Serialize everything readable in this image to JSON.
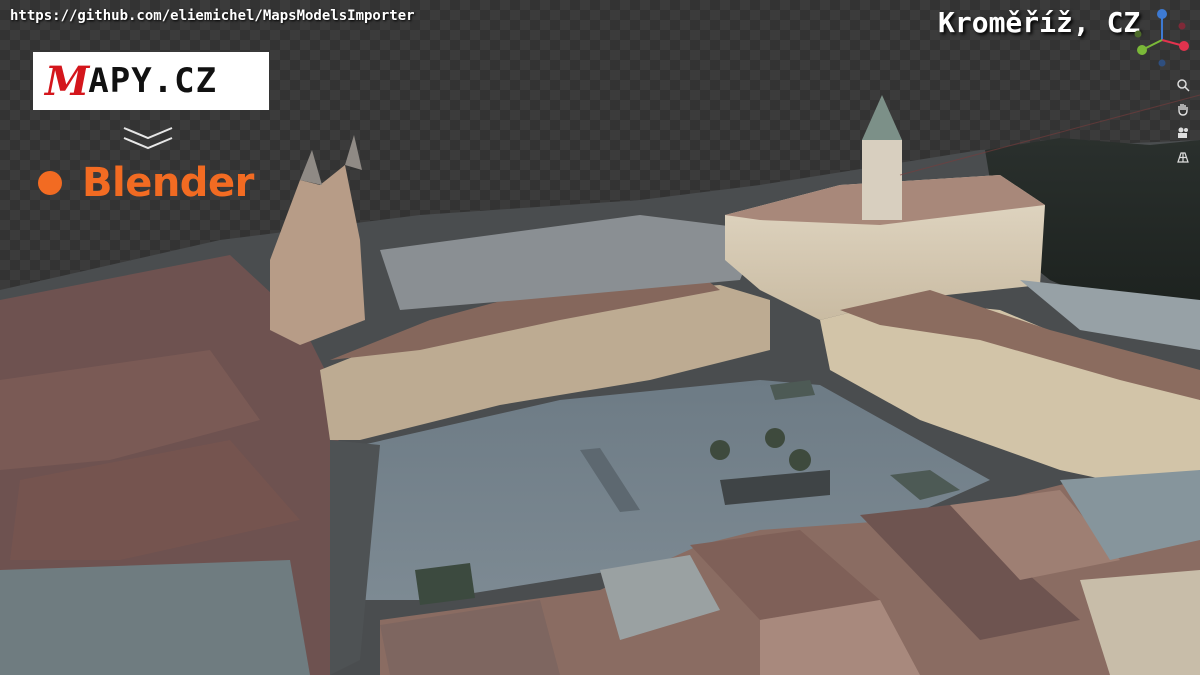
{
  "overlay": {
    "repo_url": "https://github.com/eliemichel/MapsModelsImporter",
    "mapy_logo_first": "M",
    "mapy_logo_rest": "APY.CZ",
    "blender_label": "Blender",
    "location": "Kroměříž, CZ"
  },
  "viewport": {
    "gizmo_axes": [
      "x",
      "y",
      "z"
    ],
    "nav_buttons": [
      "zoom-icon",
      "pan-hand-icon",
      "camera-icon",
      "grid-icon"
    ]
  },
  "colors": {
    "blender_orange": "#f26b22",
    "mapy_red": "#d4161c",
    "viewport_bg": "#3b3b3b",
    "axis_x": "#e2334e",
    "axis_y": "#7ab838",
    "axis_z": "#3d7ad3"
  }
}
